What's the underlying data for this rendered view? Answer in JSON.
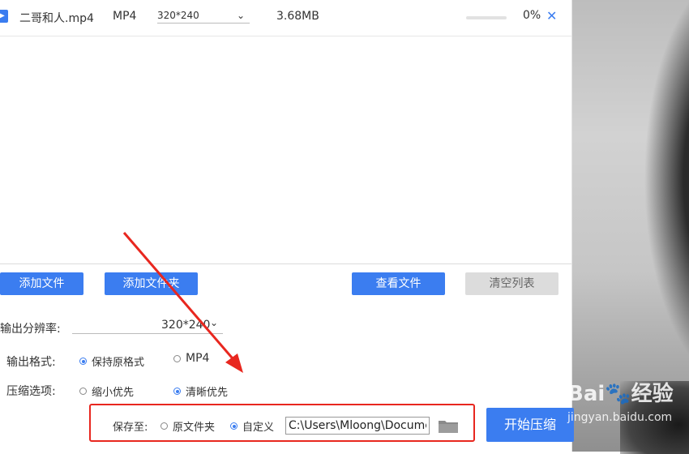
{
  "file_row": {
    "name": "二哥和人.mp4",
    "format": "MP4",
    "resolution": "320*240",
    "size": "3.68MB",
    "progress_fraction": 0,
    "percent": "0%"
  },
  "buttons": {
    "add_file": "添加文件",
    "add_folder": "添加文件夹",
    "view_file": "查看文件",
    "clear_list": "清空列表",
    "start": "开始压缩"
  },
  "options": {
    "resolution_label": "输出分辨率:",
    "resolution_value": "320*240",
    "format_label": "输出格式:",
    "format_keep": "保持原格式",
    "format_mp4": "MP4",
    "compress_label": "压缩选项:",
    "compress_small": "缩小优先",
    "compress_clear": "清晰优先"
  },
  "save": {
    "label": "保存至:",
    "original_folder": "原文件夹",
    "custom": "自定义",
    "path": "C:\\Users\\Mloong\\Documents"
  },
  "watermark": {
    "brand": "Bai",
    "brand_cn": "经验",
    "site": "jingyan.baidu.com"
  },
  "colors": {
    "accent": "#3b7df0",
    "highlight": "#e8271f"
  }
}
